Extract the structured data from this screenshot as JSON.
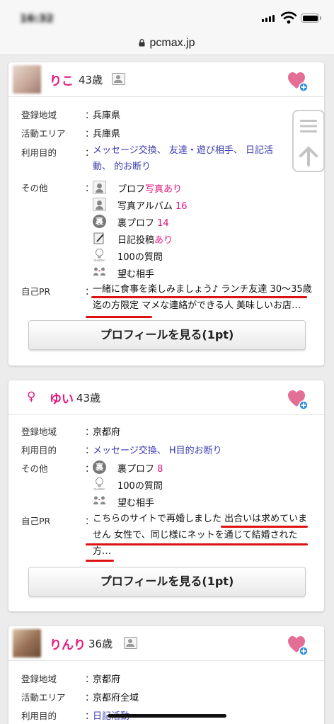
{
  "status_bar": {
    "time": "16:32",
    "url": "pcmax.jp"
  },
  "colors": {
    "accent_pink": "#e2177f",
    "link_blue": "#3b3bb0",
    "annotation_red": "#dd1111"
  },
  "profiles": [
    {
      "name": "りこ",
      "age": "43歳",
      "fields": [
        {
          "label": "登録地域",
          "value": "兵庫県"
        },
        {
          "label": "活動エリア",
          "value": "兵庫県"
        },
        {
          "label": "利用目的",
          "value": "メッセージ交換、 友達・遊び相手、 日記活動、 的お断り"
        }
      ],
      "other_label": "その他",
      "other": [
        {
          "icon": "profile-photo-icon",
          "text": "プロフ",
          "highlight": "写真あり"
        },
        {
          "icon": "photo-album-icon",
          "text": "写真アルバム ",
          "highlight": "16"
        },
        {
          "icon": "ura-profile-icon",
          "icon_text": "裏",
          "text": "裏プロフ ",
          "highlight": "14"
        },
        {
          "icon": "diary-icon",
          "text": "日記投稿",
          "highlight": "あり"
        },
        {
          "icon": "question-bulb-icon",
          "text": "100の質問",
          "highlight": ""
        },
        {
          "icon": "wanted-partner-icon",
          "text": "望む相手",
          "highlight": ""
        }
      ],
      "pr_label": "自己PR",
      "pr": "一緒に食事を楽しみましょう♪ ランチ友達 30〜35歳迄の方限定 マメな連絡ができる人 美味しいお店…",
      "button": "プロフィールを見る(1pt)"
    },
    {
      "name": "ゆい",
      "gender_symbol": "♀",
      "age": "43歳",
      "fields": [
        {
          "label": "登録地域",
          "value": "京都府"
        },
        {
          "label": "利用目的",
          "value": "メッセージ交換、 H目的お断り"
        }
      ],
      "other_label": "その他",
      "other": [
        {
          "icon": "ura-profile-icon",
          "icon_text": "裏",
          "text": "裏プロフ ",
          "highlight": "8"
        },
        {
          "icon": "question-bulb-icon",
          "text": "100の質問",
          "highlight": ""
        },
        {
          "icon": "wanted-partner-icon",
          "text": "望む相手",
          "highlight": ""
        }
      ],
      "pr_label": "自己PR",
      "pr": "こちらのサイトで再婚しました 出合いは求めていません 女性で、同じ様にネットを通じて結婚された方…",
      "button": "プロフィールを見る(1pt)"
    },
    {
      "name": "りんり",
      "age": "36歳",
      "fields": [
        {
          "label": "登録地域",
          "value": "京都府"
        },
        {
          "label": "活動エリア",
          "value": "京都府全域"
        },
        {
          "label": "利用目的",
          "value": "日記活動"
        }
      ]
    }
  ]
}
